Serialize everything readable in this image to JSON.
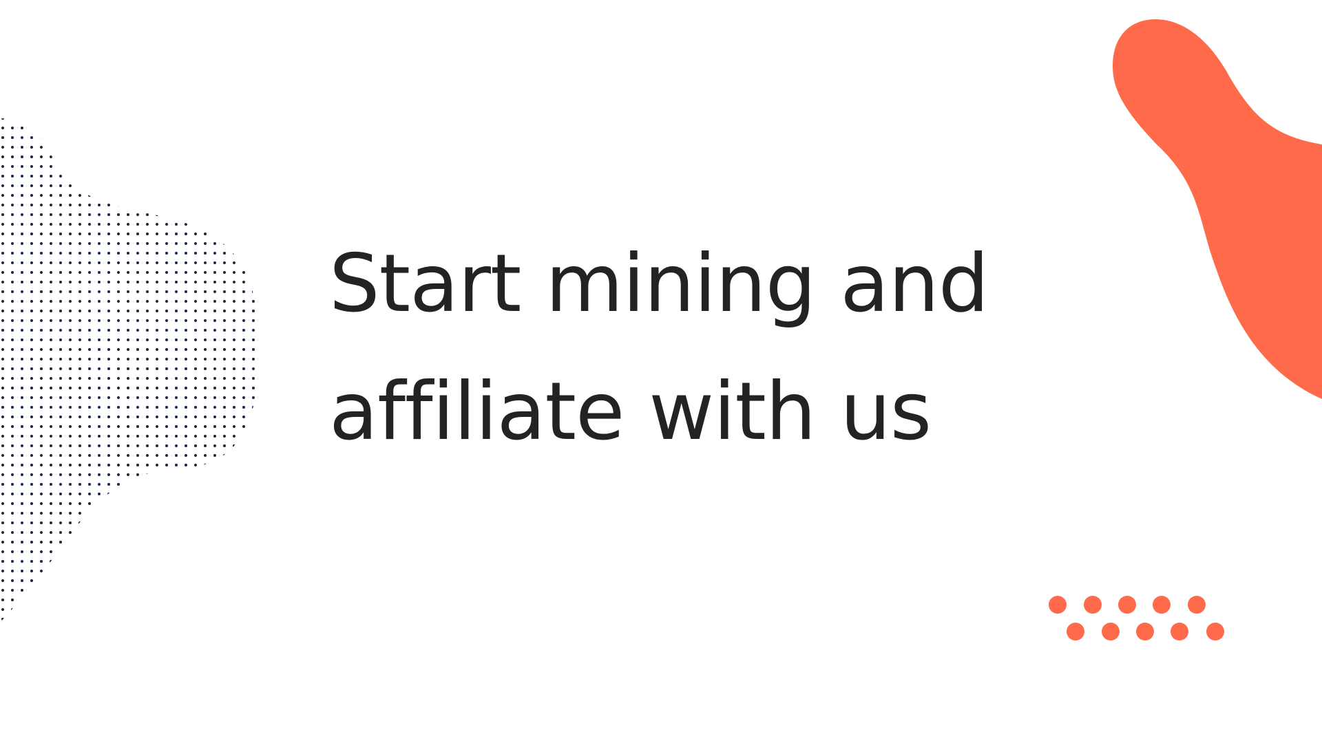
{
  "headline": {
    "line1": "Start mining and",
    "line2": "affiliate with us"
  },
  "colors": {
    "background": "#ffffff",
    "text": "#232323",
    "accent": "#ff6b4a",
    "dots": "#1f2d4a"
  },
  "decorations": {
    "left_shape": "dotted-blob",
    "top_right_shape": "orange-blob",
    "bottom_right_shape": "orange-dot-grid"
  }
}
